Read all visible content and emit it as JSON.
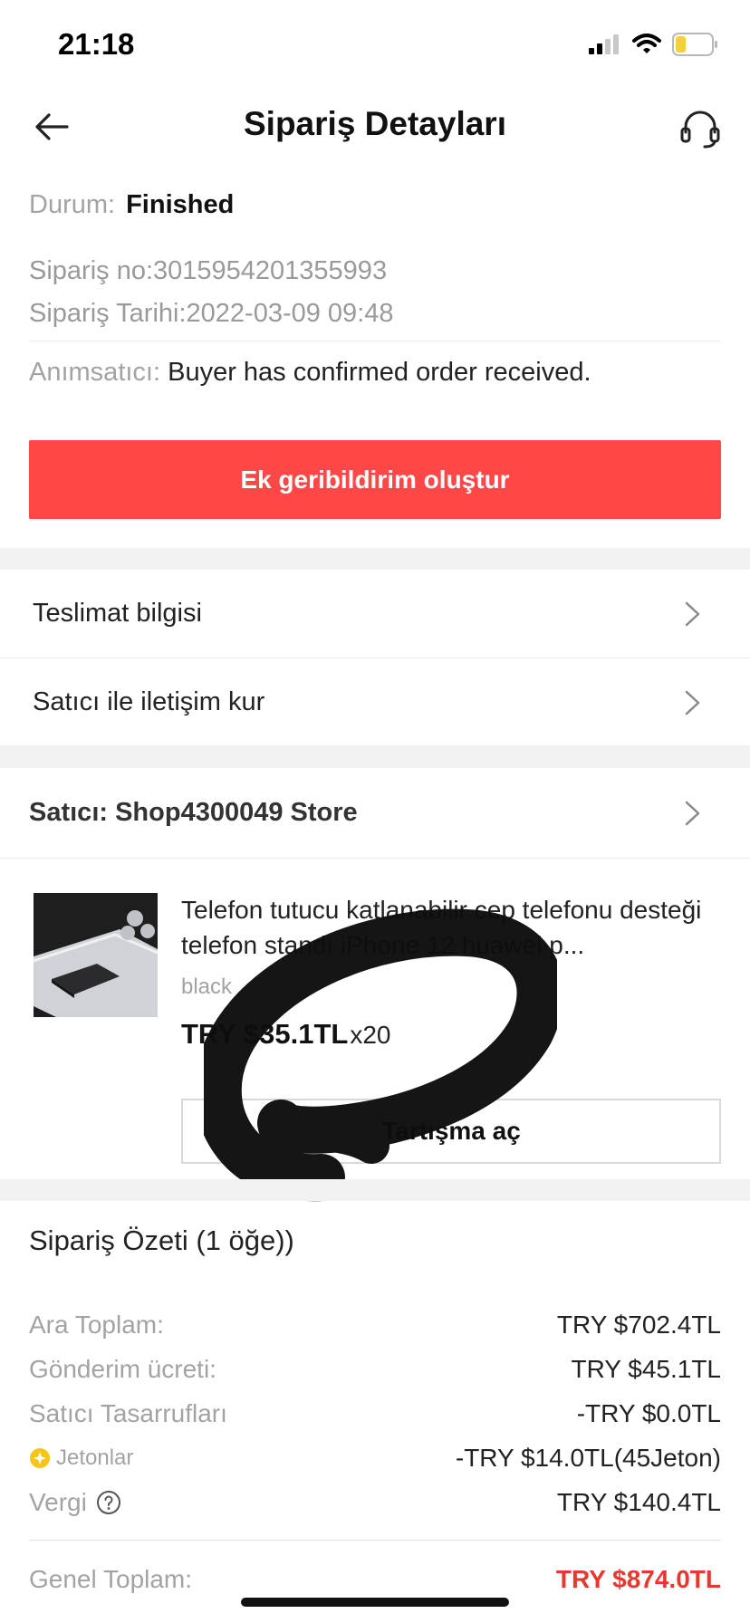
{
  "status_bar": {
    "time": "21:18"
  },
  "header": {
    "title": "Sipariş Detayları"
  },
  "order": {
    "status_label": "Durum:",
    "status_value": "Finished",
    "order_no": "Sipariş no:3015954201355993",
    "order_date": "Sipariş Tarihi:2022-03-09 09:48",
    "reminder_label": "Anımsatıcı:",
    "reminder_value": "Buyer has confirmed order received."
  },
  "actions": {
    "feedback_button": "Ek geribildirim oluştur"
  },
  "menu": {
    "delivery_info": "Teslimat bilgisi",
    "contact_seller": "Satıcı ile iletişim kur"
  },
  "seller": {
    "label": "Satıcı: Shop4300049 Store"
  },
  "product": {
    "title": "Telefon tutucu katlanabilir cep telefonu desteği telefon standı iPhone 12 huawei p...",
    "variant": "black",
    "price": "TRY $35.1TL",
    "quantity": "x20",
    "dispute_button": "Tartışma aç"
  },
  "summary": {
    "title": "Sipariş Özeti  (1 öğe))",
    "subtotal_label": "Ara Toplam:",
    "subtotal_value": "TRY $702.4TL",
    "shipping_label": "Gönderim ücreti:",
    "shipping_value": "TRY $45.1TL",
    "seller_savings_label": "Satıcı Tasarrufları",
    "seller_savings_value": "-TRY $0.0TL",
    "coins_label": "Jetonlar",
    "coins_value": "-TRY $14.0TL(45Jeton)",
    "tax_label": "Vergi",
    "tax_value": "TRY $140.4TL",
    "total_label": "Genel Toplam:",
    "total_value": "TRY $874.0TL"
  },
  "colors": {
    "primary_red": "#ff4747",
    "total_red": "#e8382e",
    "coin_yellow": "#f5c518",
    "battery_yellow": "#f4d03f"
  },
  "icons": [
    "back-arrow-icon",
    "headset-icon",
    "chevron-right-icon",
    "coin-icon",
    "help-icon",
    "signal-icon",
    "wifi-icon",
    "battery-icon"
  ]
}
